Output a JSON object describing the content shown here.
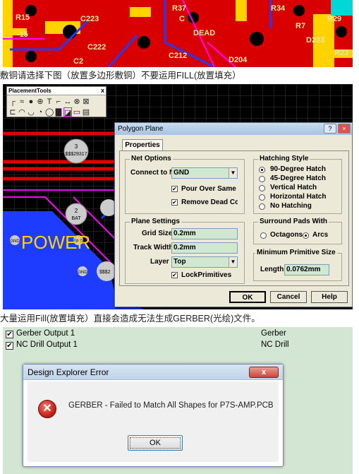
{
  "captions": {
    "first": "敷铜请选择下图（放置多边形敷铜）不要运用FILL(放置填充）",
    "second": "大量运用Fill(放置填充）直接会造成无法生成GERBER(光绘)文件。"
  },
  "pcb_top": {
    "labels": [
      "R15",
      "C223",
      "R37",
      "R34",
      "C",
      "C2",
      "-15",
      "C222",
      "DEAD",
      "D204",
      "D203",
      "R23",
      "R29",
      "C212",
      "R7"
    ]
  },
  "placement_tools": {
    "title": "PlacementTools",
    "close": "x"
  },
  "pcb_mid": {
    "pads": [
      {
        "num": "3",
        "net": "$$$29317"
      },
      {
        "num": "2",
        "net": "BAT"
      }
    ],
    "gnd_label": "GND",
    "text_power": "POWER",
    "net_partial": "$$$2"
  },
  "polygon_dialog": {
    "title": "Polygon Plane",
    "title_buttons": [
      "?",
      "×"
    ],
    "tab": "Properties",
    "net_options": {
      "title": "Net Options",
      "connect_label": "Connect to N",
      "connect_value": "GND",
      "pour_over_same": "Pour Over Same",
      "remove_dead": "Remove Dead Cc",
      "pour_checked": true,
      "remove_checked": true
    },
    "hatching": {
      "title": "Hatching Style",
      "options": [
        "90-Degree Hatch",
        "45-Degree Hatch",
        "Vertical Hatch",
        "Horizontal Hatch",
        "No Hatching"
      ],
      "selected": "90-Degree Hatch"
    },
    "plane_settings": {
      "title": "Plane Settings",
      "grid_label": "Grid Size",
      "grid_value": "0.2mm",
      "track_label": "Track Width",
      "track_value": "0.2mm",
      "layer_label": "Layer",
      "layer_value": "Top",
      "lock_label": "LockPrimitives",
      "lock_checked": true
    },
    "surround": {
      "title": "Surround Pads With",
      "options": [
        "Octagons",
        "Arcs"
      ],
      "selected": "Arcs"
    },
    "min_primitive": {
      "title": "Minimum Primitive Size",
      "length_label": "Length",
      "length_value": "0.0762mm"
    },
    "buttons": {
      "ok": "OK",
      "cancel": "Cancel",
      "help": "Help"
    }
  },
  "outputs": [
    {
      "name": "Gerber Output 1",
      "type": "Gerber",
      "checked": true
    },
    {
      "name": "NC Drill Output 1",
      "type": "NC Drill",
      "checked": true
    }
  ],
  "error_dialog": {
    "title": "Design Explorer Error",
    "close": "x",
    "message": "GERBER - Failed to Match All Shapes for P7S-AMP.PCB",
    "ok": "OK"
  },
  "colors": {
    "board": "#000000",
    "track_red": "#e00000",
    "track_blue": "#1e3cff",
    "pad_yellow": "#ffd200",
    "dialog_bg": "#ece9d8",
    "input_green": "#cfe8cf",
    "output_bg": "#d3e6d3"
  }
}
